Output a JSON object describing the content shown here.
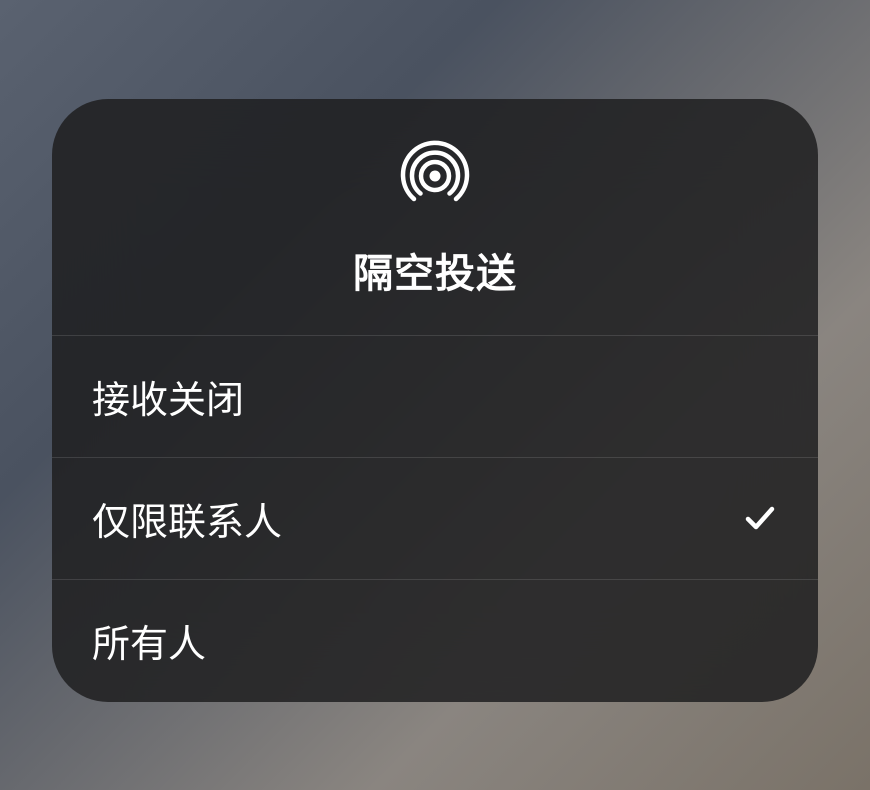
{
  "panel": {
    "title": "隔空投送",
    "icon": "airdrop-icon",
    "options": [
      {
        "label": "接收关闭",
        "selected": false
      },
      {
        "label": "仅限联系人",
        "selected": true
      },
      {
        "label": "所有人",
        "selected": false
      }
    ]
  }
}
